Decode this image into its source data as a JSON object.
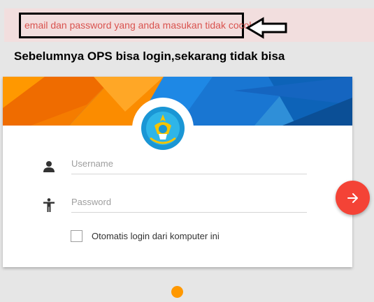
{
  "alert": {
    "message": "email dan password yang anda masukan tidak cocok"
  },
  "annotation": {
    "question": "Sebelumnya OPS bisa login,sekarang tidak bisa"
  },
  "login": {
    "username_placeholder": "Username",
    "password_placeholder": "Password",
    "remember_label": "Otomatis login dari komputer ini",
    "remember_checked": false
  },
  "icons": {
    "username": "person-icon",
    "password": "accessibility-icon",
    "submit": "arrow-right-icon",
    "annotation": "left-arrow-icon"
  },
  "colors": {
    "alert_bg": "#f2dede",
    "alert_text": "#d9534f",
    "submit_button": "#f44336",
    "loader": "#ff9800"
  }
}
